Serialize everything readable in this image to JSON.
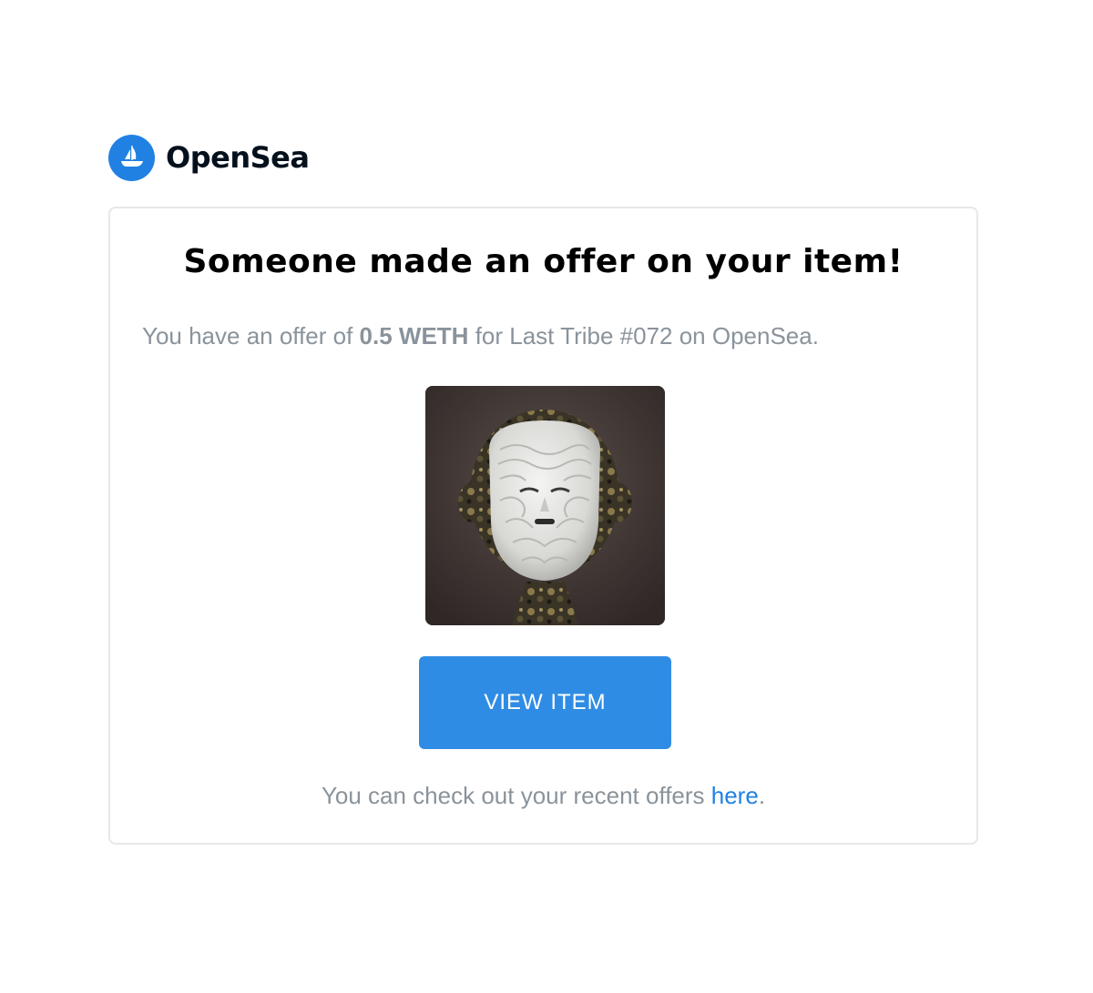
{
  "brand": {
    "name": "OpenSea",
    "logo_icon": "sailboat-icon",
    "accent_color": "#2081e2"
  },
  "email": {
    "headline": "Someone made an offer on your item!",
    "offer": {
      "prefix": "You have an offer of ",
      "amount": "0.5 WETH",
      "suffix": " for Last Tribe #072 on OpenSea."
    },
    "item_image": {
      "icon": "nft-mask-figure-image"
    },
    "cta_label": "VIEW ITEM",
    "footer": {
      "prefix": "You can check out your recent offers ",
      "link_label": "here",
      "suffix": "."
    }
  }
}
